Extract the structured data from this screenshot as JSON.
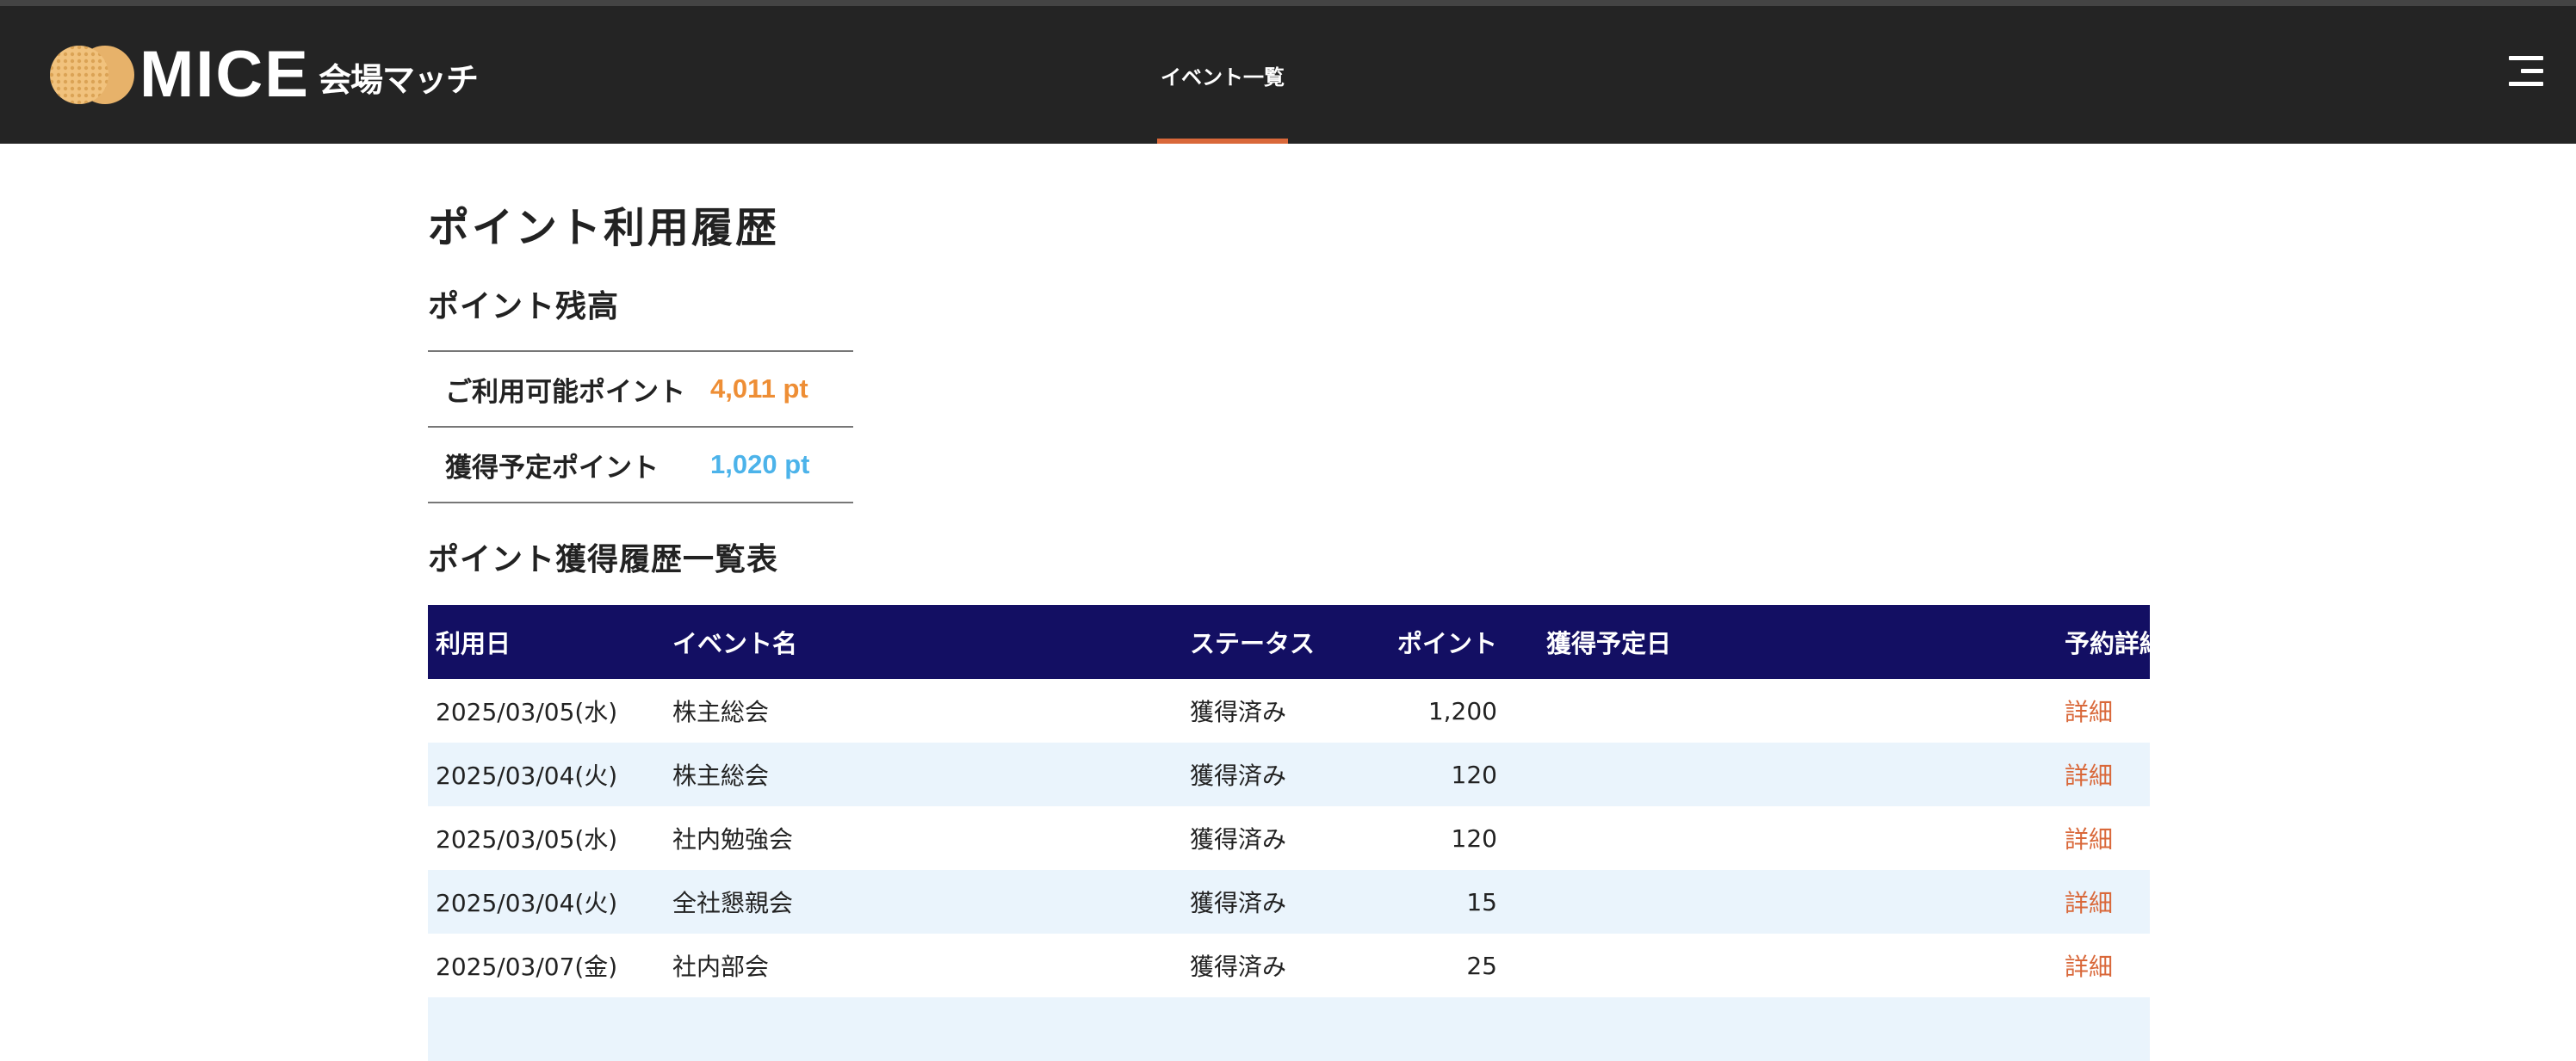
{
  "header": {
    "logo_text": "MICE",
    "logo_sub": "会場マッチ",
    "nav_events": "イベント一覧",
    "menu_icon": "hamburger-menu-icon",
    "accent_color": "#d9683a",
    "background_color": "#242424"
  },
  "page": {
    "title": "ポイント利用履歴"
  },
  "balance": {
    "section_title": "ポイント残高",
    "available_label": "ご利用可能ポイント",
    "available_value": "4,011 pt",
    "available_color": "#ee8e35",
    "pending_label": "獲得予定ポイント",
    "pending_value": "1,020 pt",
    "pending_color": "#4cb3ea"
  },
  "history": {
    "section_title": "ポイント獲得履歴一覧表",
    "header_color": "#130f63",
    "columns": {
      "date": "利用日",
      "event": "イベント名",
      "status": "ステータス",
      "points": "ポイント",
      "scheduled_date": "獲得予定日",
      "detail": "予約詳細"
    },
    "rows": [
      {
        "date": "2025/03/05(水)",
        "event": "株主総会",
        "status": "獲得済み",
        "points": "1,200",
        "scheduled_date": "",
        "detail": "詳細"
      },
      {
        "date": "2025/03/04(火)",
        "event": "株主総会",
        "status": "獲得済み",
        "points": "120",
        "scheduled_date": "",
        "detail": "詳細"
      },
      {
        "date": "2025/03/05(水)",
        "event": "社内勉強会",
        "status": "獲得済み",
        "points": "120",
        "scheduled_date": "",
        "detail": "詳細"
      },
      {
        "date": "2025/03/04(火)",
        "event": "全社懇親会",
        "status": "獲得済み",
        "points": "15",
        "scheduled_date": "",
        "detail": "詳細"
      },
      {
        "date": "2025/03/07(金)",
        "event": "社内部会",
        "status": "獲得済み",
        "points": "25",
        "scheduled_date": "",
        "detail": "詳細"
      }
    ]
  }
}
